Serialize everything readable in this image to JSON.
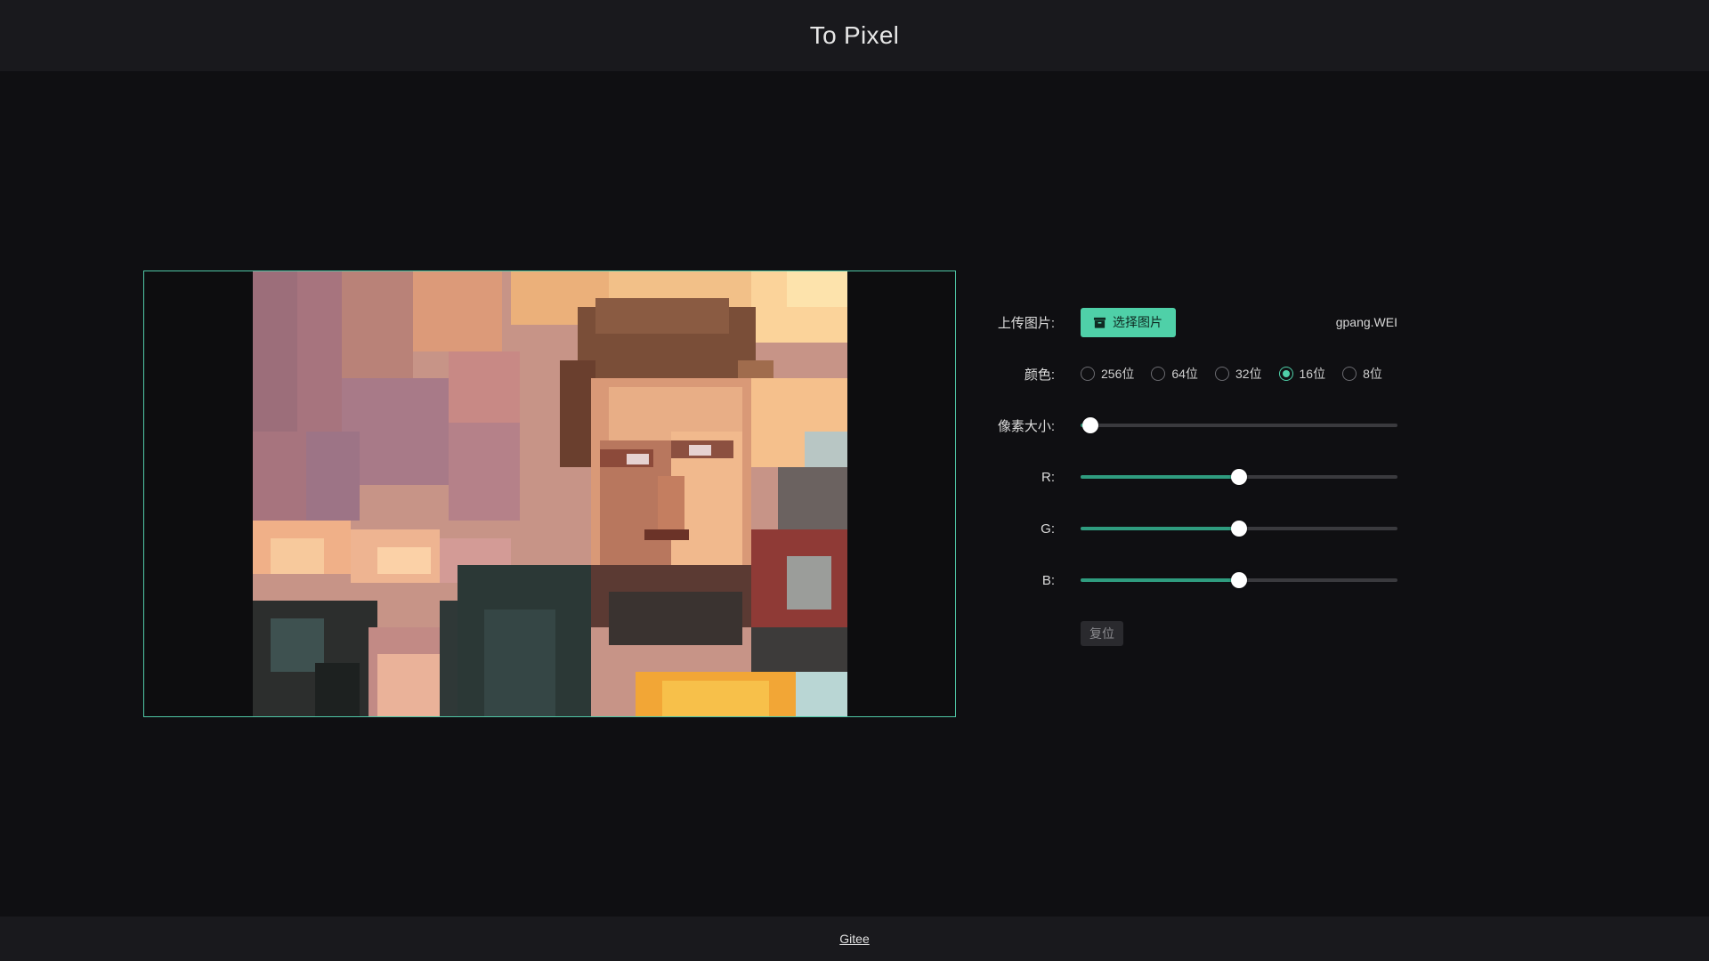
{
  "app": {
    "title": "To Pixel"
  },
  "preview": {
    "image_description_icon": "pixelated-portrait",
    "border_color": "#4fc7a6"
  },
  "controls": {
    "upload": {
      "label": "上传图片:",
      "button_label": "选择图片",
      "button_icon": "archive-icon",
      "filename": "gpang.WEI"
    },
    "color": {
      "label": "颜色:",
      "options": [
        "256位",
        "64位",
        "32位",
        "16位",
        "8位"
      ],
      "selected": "16位"
    },
    "pixel_size": {
      "label": "像素大小:",
      "value_fraction": 0.03
    },
    "r": {
      "label": "R:",
      "value_fraction": 0.5
    },
    "g": {
      "label": "G:",
      "value_fraction": 0.5
    },
    "b": {
      "label": "B:",
      "value_fraction": 0.5
    },
    "reset_label": "复位"
  },
  "footer": {
    "link_label": "Gitee"
  },
  "colors": {
    "accent": "#4fd0a8",
    "slider_track": "#2f9c7f",
    "background": "#0f0f12",
    "bar": "#19191d"
  }
}
